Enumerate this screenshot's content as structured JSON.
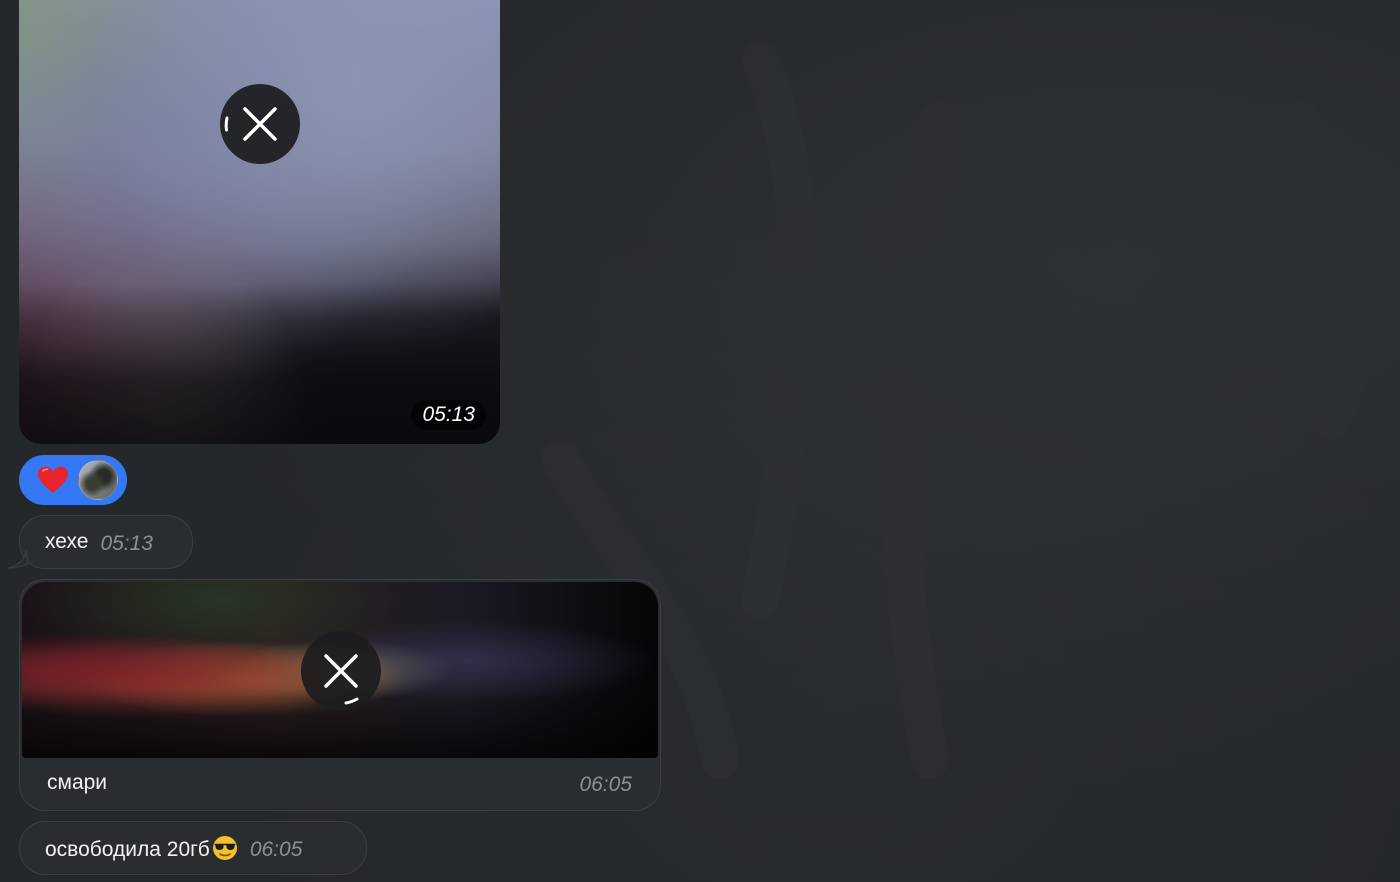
{
  "colors": {
    "background": "#25282b",
    "bubble": "#2a2d30",
    "reaction_accent": "#3478f6",
    "time_text": "#8c9096"
  },
  "messages": [
    {
      "type": "media",
      "time": "05:13",
      "state": "downloading",
      "icon": "cancel-x-icon"
    },
    {
      "type": "reaction",
      "emoji": "❤️",
      "icon": "heart-icon"
    },
    {
      "type": "text",
      "text": "хехе",
      "time": "05:13"
    },
    {
      "type": "media",
      "caption": "смари",
      "time": "06:05",
      "state": "downloading",
      "icon": "cancel-x-icon"
    },
    {
      "type": "text",
      "text": "освободила 20гб",
      "emoji": "😎",
      "time": "06:05"
    }
  ]
}
